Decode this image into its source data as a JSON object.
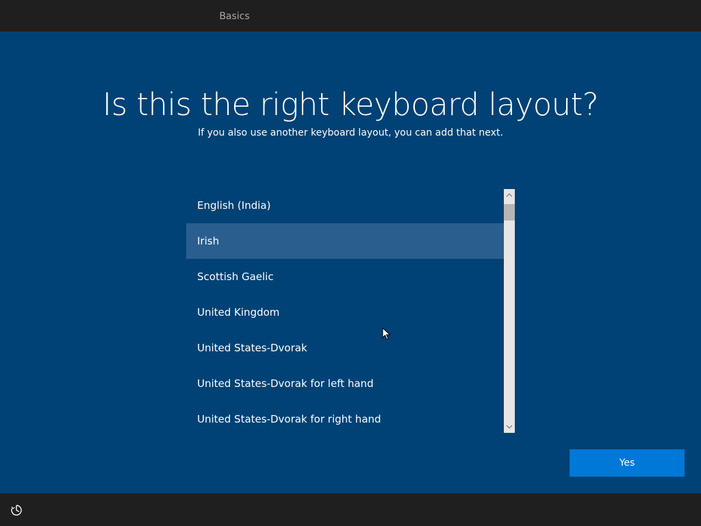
{
  "header": {
    "tabs": [
      {
        "label": "Basics"
      }
    ]
  },
  "main": {
    "title": "Is this the right keyboard layout?",
    "subtitle": "If you also use another keyboard layout, you can add that next.",
    "layouts": [
      {
        "label": "English (India)"
      },
      {
        "label": "Irish",
        "selected": true
      },
      {
        "label": "Scottish Gaelic"
      },
      {
        "label": "United Kingdom"
      },
      {
        "label": "United States-Dvorak"
      },
      {
        "label": "United States-Dvorak for left hand"
      },
      {
        "label": "United States-Dvorak for right hand"
      }
    ],
    "yes_label": "Yes"
  },
  "footer": {
    "icon": "accessibility-icon"
  },
  "colors": {
    "background": "#004275",
    "topbar": "#1f1f1f",
    "selected_row": "#2a5e8e",
    "button": "#0078d7"
  }
}
